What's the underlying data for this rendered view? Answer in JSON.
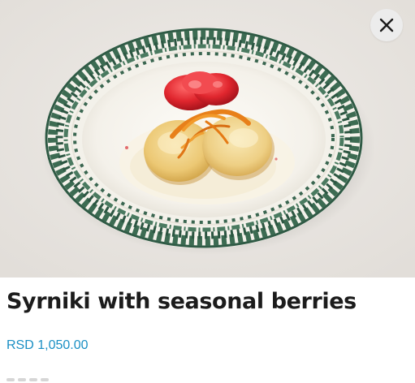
{
  "dish": {
    "title": "Syrniki with seasonal berries",
    "price": "RSD 1,050.00"
  },
  "icons": {
    "close": "close-icon",
    "photo": "dish-photo"
  },
  "colors": {
    "price": "#1a8fc4",
    "title": "#1c1c1c",
    "photo_background": "#e8e4e0",
    "close_button_bg": "#ececec"
  }
}
